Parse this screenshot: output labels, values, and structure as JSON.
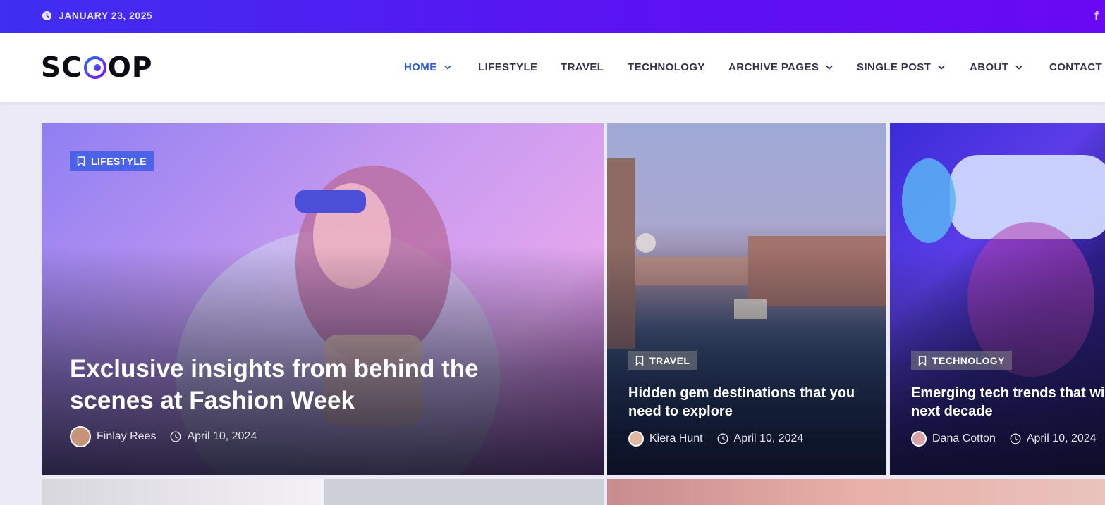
{
  "topbar": {
    "date": "JANUARY 23, 2025",
    "social_icon": "f"
  },
  "header": {
    "logo_left": "SC",
    "logo_right": "OP",
    "nav": [
      {
        "label": "HOME",
        "dropdown": true,
        "active": true
      },
      {
        "label": "LIFESTYLE",
        "dropdown": false
      },
      {
        "label": "TRAVEL",
        "dropdown": false
      },
      {
        "label": "TECHNOLOGY",
        "dropdown": false
      },
      {
        "label": "ARCHIVE PAGES",
        "dropdown": true
      },
      {
        "label": "SINGLE POST",
        "dropdown": true
      },
      {
        "label": "ABOUT",
        "dropdown": true
      },
      {
        "label": "CONTACT",
        "dropdown": false
      }
    ]
  },
  "featured": [
    {
      "category": "LIFESTYLE",
      "title": "Exclusive insights from behind the scenes at Fashion Week",
      "author": "Finlay Rees",
      "date": "April 10, 2024"
    },
    {
      "category": "TRAVEL",
      "title": "Hidden gem destinations that you need to explore",
      "author": "Kiera Hunt",
      "date": "April 10, 2024"
    },
    {
      "category": "TECHNOLOGY",
      "title": "Emerging tech trends that will define the next decade",
      "author": "Dana Cotton",
      "date": "April 10, 2024"
    }
  ],
  "colors": {
    "accent": "#2c5bd4",
    "topbar_start": "#3f2ff0",
    "topbar_end": "#6a08f4",
    "badge_lifestyle": "#4a63e8"
  }
}
